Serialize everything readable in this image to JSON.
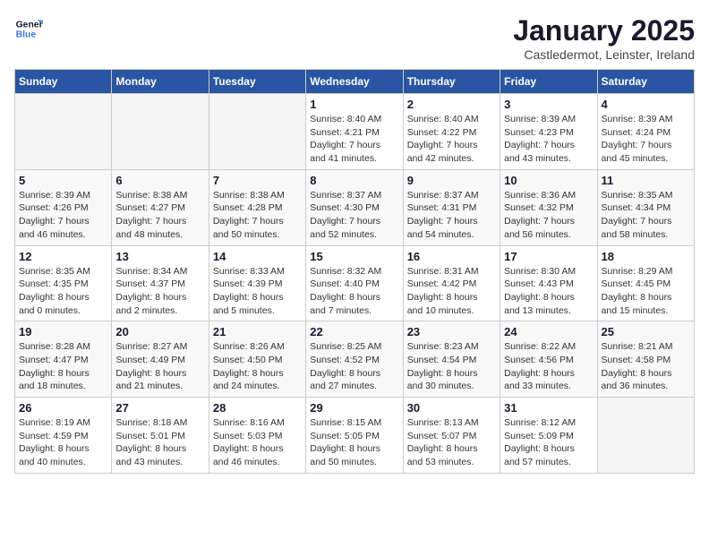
{
  "header": {
    "logo_line1": "General",
    "logo_line2": "Blue",
    "month": "January 2025",
    "location": "Castledermot, Leinster, Ireland"
  },
  "weekdays": [
    "Sunday",
    "Monday",
    "Tuesday",
    "Wednesday",
    "Thursday",
    "Friday",
    "Saturday"
  ],
  "weeks": [
    [
      {
        "day": "",
        "info": ""
      },
      {
        "day": "",
        "info": ""
      },
      {
        "day": "",
        "info": ""
      },
      {
        "day": "1",
        "info": "Sunrise: 8:40 AM\nSunset: 4:21 PM\nDaylight: 7 hours\nand 41 minutes."
      },
      {
        "day": "2",
        "info": "Sunrise: 8:40 AM\nSunset: 4:22 PM\nDaylight: 7 hours\nand 42 minutes."
      },
      {
        "day": "3",
        "info": "Sunrise: 8:39 AM\nSunset: 4:23 PM\nDaylight: 7 hours\nand 43 minutes."
      },
      {
        "day": "4",
        "info": "Sunrise: 8:39 AM\nSunset: 4:24 PM\nDaylight: 7 hours\nand 45 minutes."
      }
    ],
    [
      {
        "day": "5",
        "info": "Sunrise: 8:39 AM\nSunset: 4:26 PM\nDaylight: 7 hours\nand 46 minutes."
      },
      {
        "day": "6",
        "info": "Sunrise: 8:38 AM\nSunset: 4:27 PM\nDaylight: 7 hours\nand 48 minutes."
      },
      {
        "day": "7",
        "info": "Sunrise: 8:38 AM\nSunset: 4:28 PM\nDaylight: 7 hours\nand 50 minutes."
      },
      {
        "day": "8",
        "info": "Sunrise: 8:37 AM\nSunset: 4:30 PM\nDaylight: 7 hours\nand 52 minutes."
      },
      {
        "day": "9",
        "info": "Sunrise: 8:37 AM\nSunset: 4:31 PM\nDaylight: 7 hours\nand 54 minutes."
      },
      {
        "day": "10",
        "info": "Sunrise: 8:36 AM\nSunset: 4:32 PM\nDaylight: 7 hours\nand 56 minutes."
      },
      {
        "day": "11",
        "info": "Sunrise: 8:35 AM\nSunset: 4:34 PM\nDaylight: 7 hours\nand 58 minutes."
      }
    ],
    [
      {
        "day": "12",
        "info": "Sunrise: 8:35 AM\nSunset: 4:35 PM\nDaylight: 8 hours\nand 0 minutes."
      },
      {
        "day": "13",
        "info": "Sunrise: 8:34 AM\nSunset: 4:37 PM\nDaylight: 8 hours\nand 2 minutes."
      },
      {
        "day": "14",
        "info": "Sunrise: 8:33 AM\nSunset: 4:39 PM\nDaylight: 8 hours\nand 5 minutes."
      },
      {
        "day": "15",
        "info": "Sunrise: 8:32 AM\nSunset: 4:40 PM\nDaylight: 8 hours\nand 7 minutes."
      },
      {
        "day": "16",
        "info": "Sunrise: 8:31 AM\nSunset: 4:42 PM\nDaylight: 8 hours\nand 10 minutes."
      },
      {
        "day": "17",
        "info": "Sunrise: 8:30 AM\nSunset: 4:43 PM\nDaylight: 8 hours\nand 13 minutes."
      },
      {
        "day": "18",
        "info": "Sunrise: 8:29 AM\nSunset: 4:45 PM\nDaylight: 8 hours\nand 15 minutes."
      }
    ],
    [
      {
        "day": "19",
        "info": "Sunrise: 8:28 AM\nSunset: 4:47 PM\nDaylight: 8 hours\nand 18 minutes."
      },
      {
        "day": "20",
        "info": "Sunrise: 8:27 AM\nSunset: 4:49 PM\nDaylight: 8 hours\nand 21 minutes."
      },
      {
        "day": "21",
        "info": "Sunrise: 8:26 AM\nSunset: 4:50 PM\nDaylight: 8 hours\nand 24 minutes."
      },
      {
        "day": "22",
        "info": "Sunrise: 8:25 AM\nSunset: 4:52 PM\nDaylight: 8 hours\nand 27 minutes."
      },
      {
        "day": "23",
        "info": "Sunrise: 8:23 AM\nSunset: 4:54 PM\nDaylight: 8 hours\nand 30 minutes."
      },
      {
        "day": "24",
        "info": "Sunrise: 8:22 AM\nSunset: 4:56 PM\nDaylight: 8 hours\nand 33 minutes."
      },
      {
        "day": "25",
        "info": "Sunrise: 8:21 AM\nSunset: 4:58 PM\nDaylight: 8 hours\nand 36 minutes."
      }
    ],
    [
      {
        "day": "26",
        "info": "Sunrise: 8:19 AM\nSunset: 4:59 PM\nDaylight: 8 hours\nand 40 minutes."
      },
      {
        "day": "27",
        "info": "Sunrise: 8:18 AM\nSunset: 5:01 PM\nDaylight: 8 hours\nand 43 minutes."
      },
      {
        "day": "28",
        "info": "Sunrise: 8:16 AM\nSunset: 5:03 PM\nDaylight: 8 hours\nand 46 minutes."
      },
      {
        "day": "29",
        "info": "Sunrise: 8:15 AM\nSunset: 5:05 PM\nDaylight: 8 hours\nand 50 minutes."
      },
      {
        "day": "30",
        "info": "Sunrise: 8:13 AM\nSunset: 5:07 PM\nDaylight: 8 hours\nand 53 minutes."
      },
      {
        "day": "31",
        "info": "Sunrise: 8:12 AM\nSunset: 5:09 PM\nDaylight: 8 hours\nand 57 minutes."
      },
      {
        "day": "",
        "info": ""
      }
    ]
  ]
}
